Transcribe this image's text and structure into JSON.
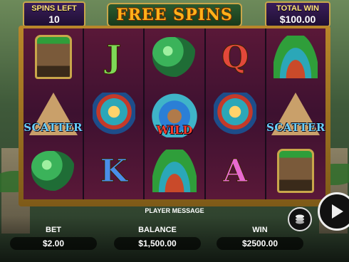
{
  "header": {
    "spins_left_label": "SPINS LEFT",
    "spins_left_value": "10",
    "title": "FREE SPINS",
    "total_win_label": "TOTAL WIN",
    "total_win_value": "$100.00"
  },
  "reels": [
    [
      {
        "symbol": "warrior"
      },
      {
        "symbol": "pyramid",
        "label": "SCATTER"
      },
      {
        "symbol": "serpent"
      }
    ],
    [
      {
        "symbol": "J"
      },
      {
        "symbol": "mask"
      },
      {
        "symbol": "K"
      }
    ],
    [
      {
        "symbol": "serpent"
      },
      {
        "symbol": "queen",
        "label": "WILD"
      },
      {
        "symbol": "headdress"
      }
    ],
    [
      {
        "symbol": "Q"
      },
      {
        "symbol": "mask"
      },
      {
        "symbol": "A"
      }
    ],
    [
      {
        "symbol": "headdress"
      },
      {
        "symbol": "pyramid",
        "label": "SCATTER"
      },
      {
        "symbol": "warrior"
      }
    ]
  ],
  "footer": {
    "player_message": "PLAYER MESSAGE",
    "bet_label": "BET",
    "bet_value": "$2.00",
    "balance_label": "BALANCE",
    "balance_value": "$1,500.00",
    "win_label": "WIN",
    "win_value": "$2500.00"
  },
  "colors": {
    "gold": "#c9a64a",
    "title": "#ffb21a",
    "reel_bg": "#3d1130"
  }
}
